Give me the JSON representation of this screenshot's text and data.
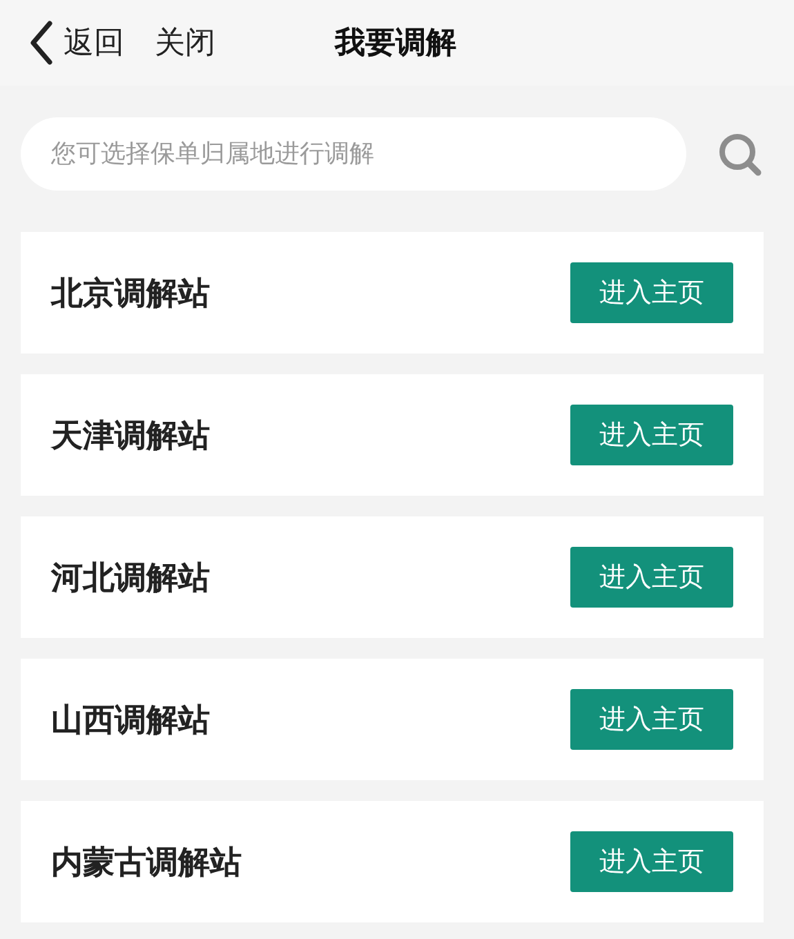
{
  "nav": {
    "back": "返回",
    "close": "关闭",
    "title": "我要调解"
  },
  "search": {
    "placeholder": "您可选择保单归属地进行调解"
  },
  "stations": [
    {
      "name": "北京调解站",
      "button": "进入主页"
    },
    {
      "name": "天津调解站",
      "button": "进入主页"
    },
    {
      "name": "河北调解站",
      "button": "进入主页"
    },
    {
      "name": "山西调解站",
      "button": "进入主页"
    },
    {
      "name": "内蒙古调解站",
      "button": "进入主页"
    }
  ]
}
